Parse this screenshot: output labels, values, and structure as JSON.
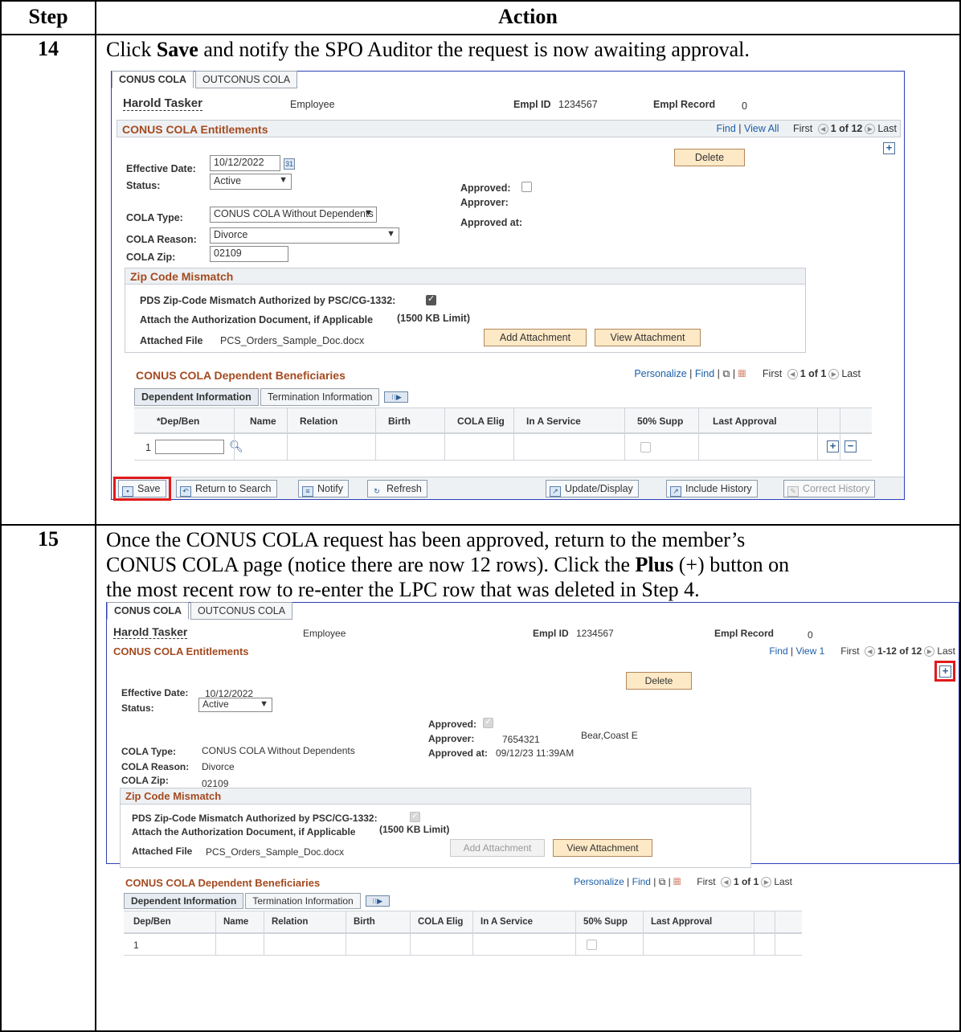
{
  "doc": {
    "header_step": "Step",
    "header_action": "Action",
    "step14": {
      "number": "14",
      "text_pre": "Click ",
      "text_bold": "Save",
      "text_post": " and notify the SPO Auditor the request is now awaiting approval."
    },
    "step15": {
      "number": "15",
      "line1": "Once the CONUS COLA request has been approved, return to the member’s",
      "line2_pre": "CONUS COLA page (notice there are now 12 rows).  Click the ",
      "line2_bold": "Plus",
      "line2_post": " (+) button on",
      "line3": "the most recent row to re-enter the LPC row that was deleted in Step 4."
    }
  },
  "shot1": {
    "tabs": [
      "CONUS COLA",
      "OUTCONUS COLA"
    ],
    "name": "Harold Tasker",
    "employee": "Employee",
    "empl_id_label": "Empl ID",
    "empl_id": "1234567",
    "empl_record_label": "Empl Record",
    "empl_record": "0",
    "section": "CONUS COLA Entitlements",
    "nav": {
      "find": "Find",
      "view": "View All",
      "first": "First",
      "count": "1 of 12",
      "last": "Last"
    },
    "delete": "Delete",
    "effective_date_label": "Effective Date:",
    "effective_date": "10/12/2022",
    "status_label": "Status:",
    "status": "Active",
    "approved_label": "Approved:",
    "approver_label": "Approver:",
    "approved_at_label": "Approved at:",
    "cola_type_label": "COLA Type:",
    "cola_type": "CONUS COLA Without Dependents",
    "cola_reason_label": "COLA Reason:",
    "cola_reason": "Divorce",
    "cola_zip_label": "COLA Zip:",
    "cola_zip": "02109",
    "zip_section": "Zip Code Mismatch",
    "pds_label": "PDS Zip-Code Mismatch Authorized by PSC/CG-1332:",
    "attach_label": "Attach the Authorization Document, if Applicable",
    "limit": "(1500 KB Limit)",
    "attached_file_label": "Attached File",
    "attached_file": "PCS_Orders_Sample_Doc.docx",
    "add_attachment": "Add Attachment",
    "view_attachment": "View Attachment",
    "dep_section": "CONUS COLA Dependent Beneficiaries",
    "dep_nav": {
      "personalize": "Personalize",
      "find": "Find",
      "first": "First",
      "count": "1 of 1",
      "last": "Last"
    },
    "dep_tabs": [
      "Dependent Information",
      "Termination Information"
    ],
    "columns": [
      "*Dep/Ben",
      "Name",
      "Relation",
      "Birth",
      "COLA Elig",
      "In A Service",
      "50% Supp",
      "Last Approval"
    ],
    "row_num": "1",
    "toolbar": {
      "save": "Save",
      "return": "Return to Search",
      "notify": "Notify",
      "refresh": "Refresh",
      "update": "Update/Display",
      "history": "Include History",
      "correct": "Correct History"
    }
  },
  "shot2": {
    "tabs": [
      "CONUS COLA",
      "OUTCONUS COLA"
    ],
    "name": "Harold Tasker",
    "employee": "Employee",
    "empl_id_label": "Empl ID",
    "empl_id": "1234567",
    "empl_record_label": "Empl Record",
    "empl_record": "0",
    "section": "CONUS COLA Entitlements",
    "nav": {
      "find": "Find",
      "view": "View 1",
      "first": "First",
      "count": "1-12 of 12",
      "last": "Last"
    },
    "delete": "Delete",
    "effective_date_label": "Effective Date:",
    "effective_date": "10/12/2022",
    "status_label": "Status:",
    "status": "Active",
    "approved_label": "Approved:",
    "approver_label": "Approver:",
    "approver_id": "7654321",
    "approver_name": "Bear,Coast E",
    "approved_at_label": "Approved at:",
    "approved_at": "09/12/23 11:39AM",
    "cola_type_label": "COLA Type:",
    "cola_type": "CONUS COLA Without Dependents",
    "cola_reason_label": "COLA Reason:",
    "cola_reason": "Divorce",
    "cola_zip_label": "COLA Zip:",
    "cola_zip": "02109",
    "zip_section": "Zip Code Mismatch",
    "pds_label": "PDS Zip-Code Mismatch Authorized by PSC/CG-1332:",
    "attach_label": "Attach the Authorization Document, if Applicable",
    "limit": "(1500 KB Limit)",
    "attached_file_label": "Attached File",
    "attached_file": "PCS_Orders_Sample_Doc.docx",
    "add_attachment": "Add Attachment",
    "view_attachment": "View Attachment",
    "dep_section": "CONUS COLA Dependent Beneficiaries",
    "dep_nav": {
      "personalize": "Personalize",
      "find": "Find",
      "first": "First",
      "count": "1 of 1",
      "last": "Last"
    },
    "dep_tabs": [
      "Dependent Information",
      "Termination Information"
    ],
    "columns": [
      "Dep/Ben",
      "Name",
      "Relation",
      "Birth",
      "COLA Elig",
      "In A Service",
      "50% Supp",
      "Last Approval"
    ],
    "row_num": "1"
  },
  "colors": {
    "highlight": "#e01b1b",
    "section_title": "#a44a1f",
    "link": "#1b5fa8",
    "frame": "#2d3fb5"
  }
}
